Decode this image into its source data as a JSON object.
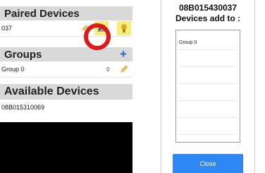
{
  "left": {
    "paired_header": "Paired Devices",
    "paired_device_id": "037",
    "groups_header": "Groups",
    "group_plus": "+",
    "group_name": "Group 0",
    "group_count": "0",
    "available_header": "Available Devices",
    "available_device_id": "08B015310069"
  },
  "right": {
    "device_id": "08B015430037",
    "devices_add_to": "Devices add to :",
    "list_items": [
      "Group 0"
    ],
    "close_label": "Close"
  },
  "colors": {
    "accent_blue": "#2f86f5",
    "highlight_red": "#e01818",
    "button_yellow": "#f4f07a"
  }
}
